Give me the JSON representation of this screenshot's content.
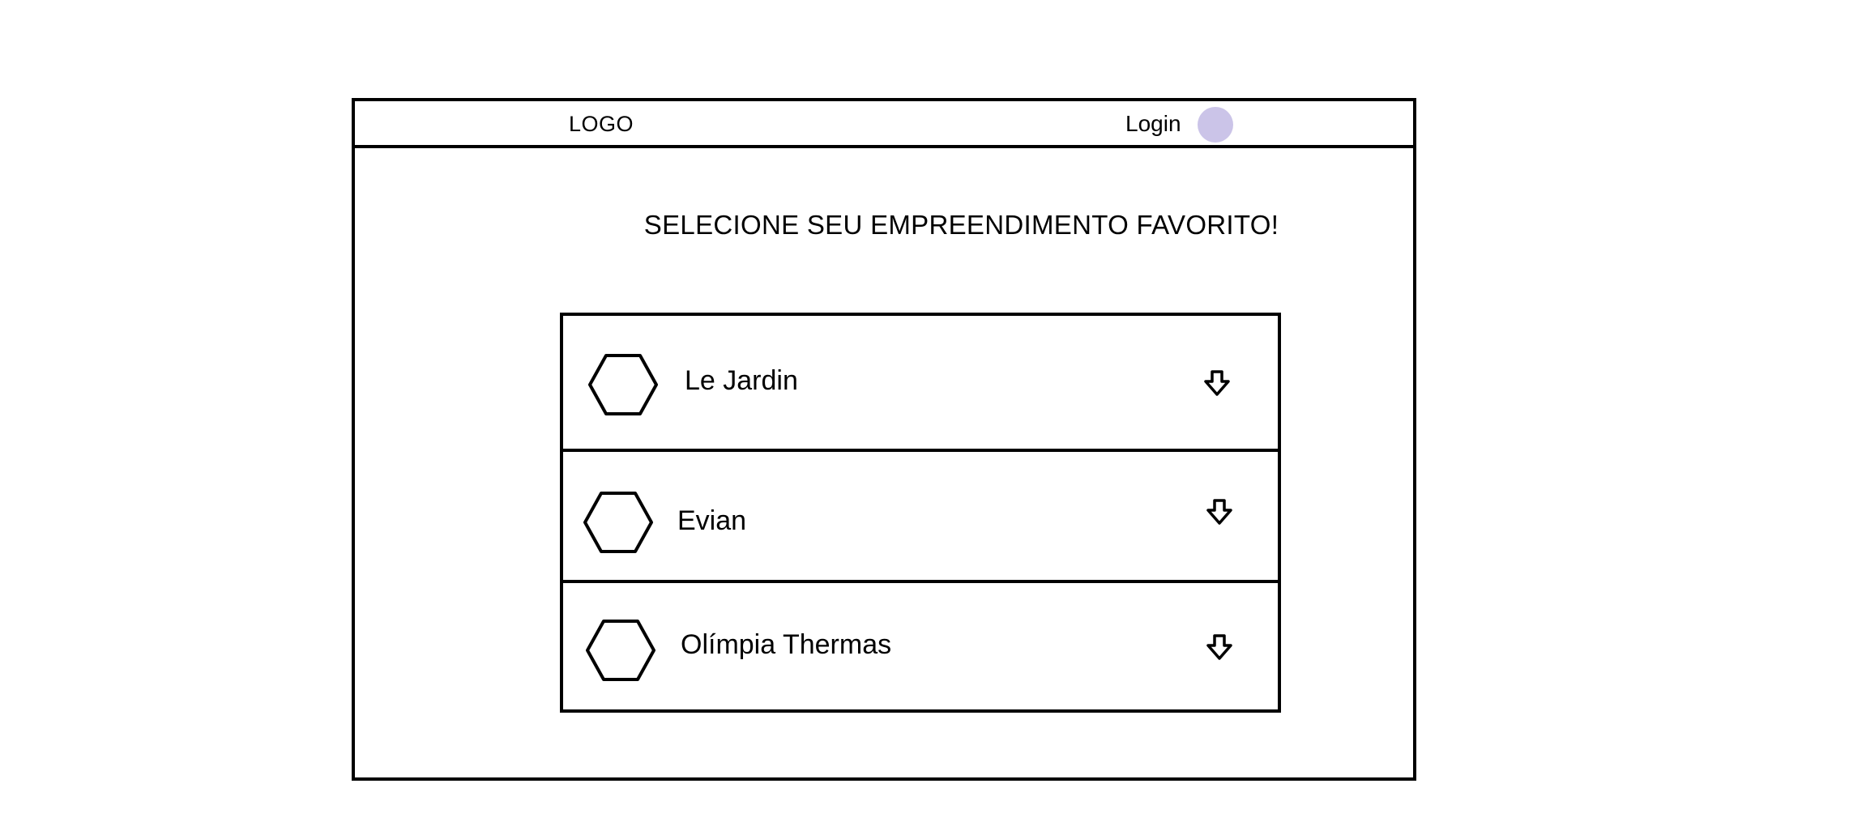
{
  "header": {
    "logo_text": "LOGO",
    "login_label": "Login"
  },
  "main": {
    "title": "SELECIONE SEU EMPREENDIMENTO FAVORITO!",
    "items": [
      {
        "label": "Le Jardin",
        "icon": "hexagon-icon",
        "action_icon": "arrow-down-icon"
      },
      {
        "label": "Evian",
        "icon": "hexagon-icon",
        "action_icon": "arrow-down-icon"
      },
      {
        "label": "Olímpia Thermas",
        "icon": "hexagon-icon",
        "action_icon": "arrow-down-icon"
      }
    ]
  },
  "colors": {
    "border": "#000000",
    "background": "#ffffff",
    "avatar": "#cbc4e8"
  }
}
